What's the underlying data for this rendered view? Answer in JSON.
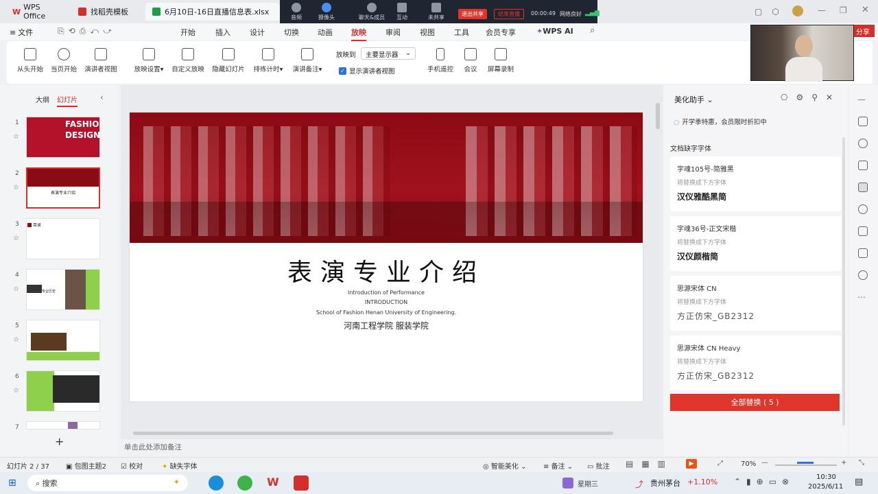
{
  "tabs": [
    {
      "label": "WPS Office",
      "color": "#d0312d"
    },
    {
      "label": "找稻壳模板",
      "color": "#d0312d"
    },
    {
      "label": "6月10日-16日直播信息表.xlsx",
      "color": "#1e9e4a"
    }
  ],
  "meeting": {
    "items": [
      "音频",
      "摄像头",
      "聊天&成员",
      "互动",
      "未共享"
    ],
    "exit_share": "退出共享",
    "end_live": "结束直播",
    "timer": "00:00:49",
    "network": "网络良好"
  },
  "menu": {
    "file": "文件",
    "items": [
      "开始",
      "插入",
      "设计",
      "切换",
      "动画",
      "放映",
      "审阅",
      "视图",
      "工具",
      "会员专享",
      "WPS AI"
    ],
    "active": "放映"
  },
  "ribbon": {
    "buttons": [
      "从头开始",
      "当页开始",
      "演讲者视图",
      "放映设置",
      "自定义放映",
      "隐藏幻灯片",
      "排练计时",
      "演讲备注",
      "手机遥控",
      "会议",
      "屏幕录制"
    ],
    "play_to_label": "放映到",
    "play_to_value": "主要显示器",
    "show_presenter": "显示演讲者视图"
  },
  "left_panel": {
    "tab_outline": "大纲",
    "tab_slides": "幻灯片",
    "numbers": [
      "1",
      "2",
      "3",
      "4",
      "5",
      "6",
      "7"
    ],
    "thumb1_text": "FASHION DESIGN",
    "thumb2_text": "表演专业介绍",
    "thumb3_text": "目录",
    "thumb4_text": "专业历史"
  },
  "slide": {
    "title": "表演专业介绍",
    "line1": "Introduction of Performance",
    "line2": "INTRODUCTION",
    "line3": "School of Fashion Henan University of Engineering.",
    "subtitle": "河南工程学院 服装学院"
  },
  "notes_placeholder": "单击此处添加备注",
  "right_panel": {
    "title": "美化助手",
    "promo": "开学季特惠，会员限时折扣中",
    "section": "文档缺字字体",
    "cards": [
      {
        "font": "字魂105号-简雅黑",
        "hint": "将替换成下方字体",
        "replacement": "汉仪雅酷黑简"
      },
      {
        "font": "字魂36号-正文宋楷",
        "hint": "将替换成下方字体",
        "replacement": "汉仪颜楷简"
      },
      {
        "font": "思源宋体 CN",
        "hint": "将替换成下方字体",
        "replacement": "方正仿宋_GB2312"
      },
      {
        "font": "思源宋体 CN Heavy",
        "hint": "将替换成下方字体",
        "replacement": "方正仿宋_GB2312"
      }
    ],
    "replace_all": "全部替换 ( 5 )"
  },
  "status": {
    "slide_pos": "幻灯片 2 / 37",
    "theme": "包图主题2",
    "proof": "校对",
    "missing": "缺失字体",
    "beautify": "智能美化",
    "notes": "备注",
    "comments": "批注",
    "zoom": "70%"
  },
  "taskbar": {
    "search": "搜索",
    "weekday": "星期三",
    "stock": "贵州茅台",
    "stock_change": "+1.10%",
    "time": "10:30",
    "date": "2025/6/11"
  },
  "colors": {
    "accent": "#d0312d",
    "banner": "#8b0b14",
    "green": "#8ed04b"
  }
}
